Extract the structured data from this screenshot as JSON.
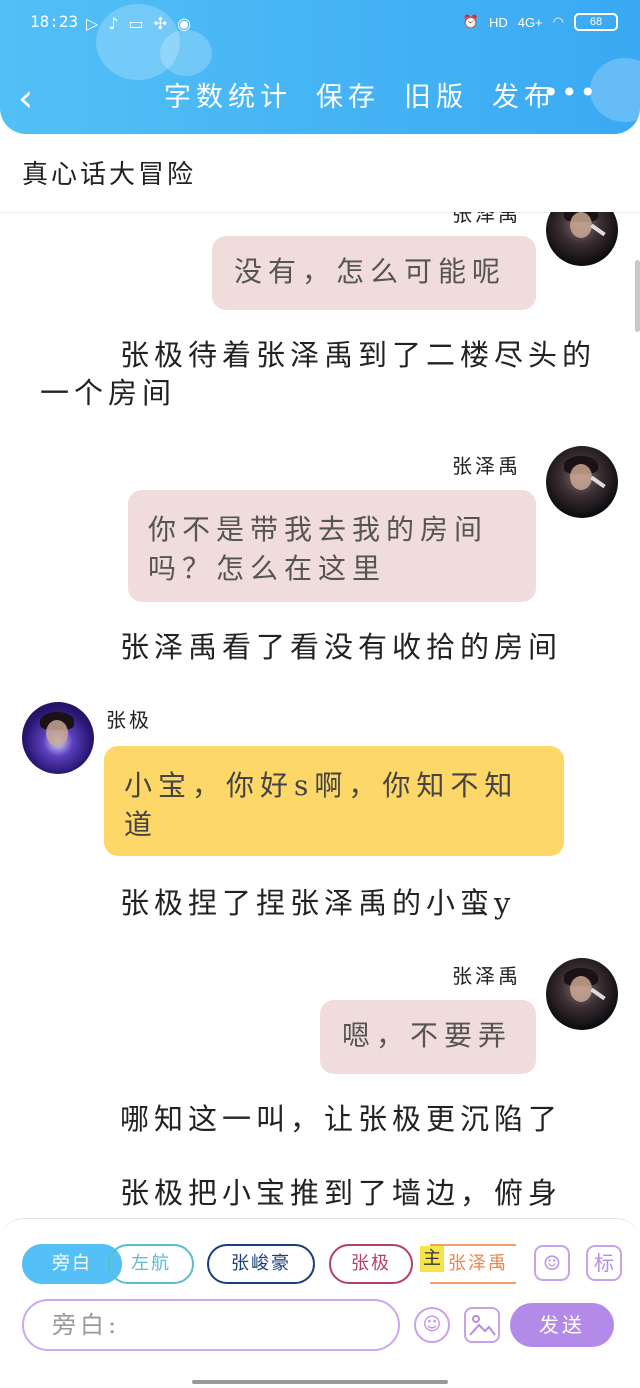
{
  "status_bar": {
    "time": "18:23",
    "network": "4G+",
    "hd": "HD",
    "battery": "68"
  },
  "header": {
    "back_icon": "chevron-left-icon",
    "actions": [
      "字数统计",
      "保存",
      "旧版",
      "发布"
    ],
    "more_icon": "more-dots-icon",
    "accent_color": "#3aa9f3"
  },
  "title": "真心话大冒险",
  "messages": [
    {
      "type": "bubble",
      "side": "right",
      "speaker": "张泽禹",
      "text": "没有，怎么可能呢",
      "color": "#f0dcdb"
    },
    {
      "type": "narration",
      "text": "张极待着张泽禹到了二楼尽头的一个房间"
    },
    {
      "type": "bubble",
      "side": "right",
      "speaker": "张泽禹",
      "text": "你不是带我去我的房间吗？怎么在这里",
      "color": "#f0dcdb"
    },
    {
      "type": "narration",
      "text": "张泽禹看了看没有收拾的房间"
    },
    {
      "type": "bubble",
      "side": "left",
      "speaker": "张极",
      "text": "小宝，你好s啊，你知不知道",
      "color": "#fdd868"
    },
    {
      "type": "narration",
      "text": "张极捏了捏张泽禹的小蛮y"
    },
    {
      "type": "bubble",
      "side": "right",
      "speaker": "张泽禹",
      "text": "嗯，不要弄",
      "color": "#f0dcdb"
    },
    {
      "type": "narration",
      "text": "哪知这一叫，让张极更沉陷了"
    },
    {
      "type": "narration",
      "text": "张极把小宝推到了墙边，俯身"
    }
  ],
  "roles": {
    "aside": "旁白",
    "zuohang": "左航",
    "zhangjunhao": "张峻豪",
    "zhangji": "张极",
    "main_tag": "主",
    "zhangzeyu": "张泽禹"
  },
  "input": {
    "placeholder": "旁白:",
    "send_label": "发送",
    "tag_button": "标"
  }
}
